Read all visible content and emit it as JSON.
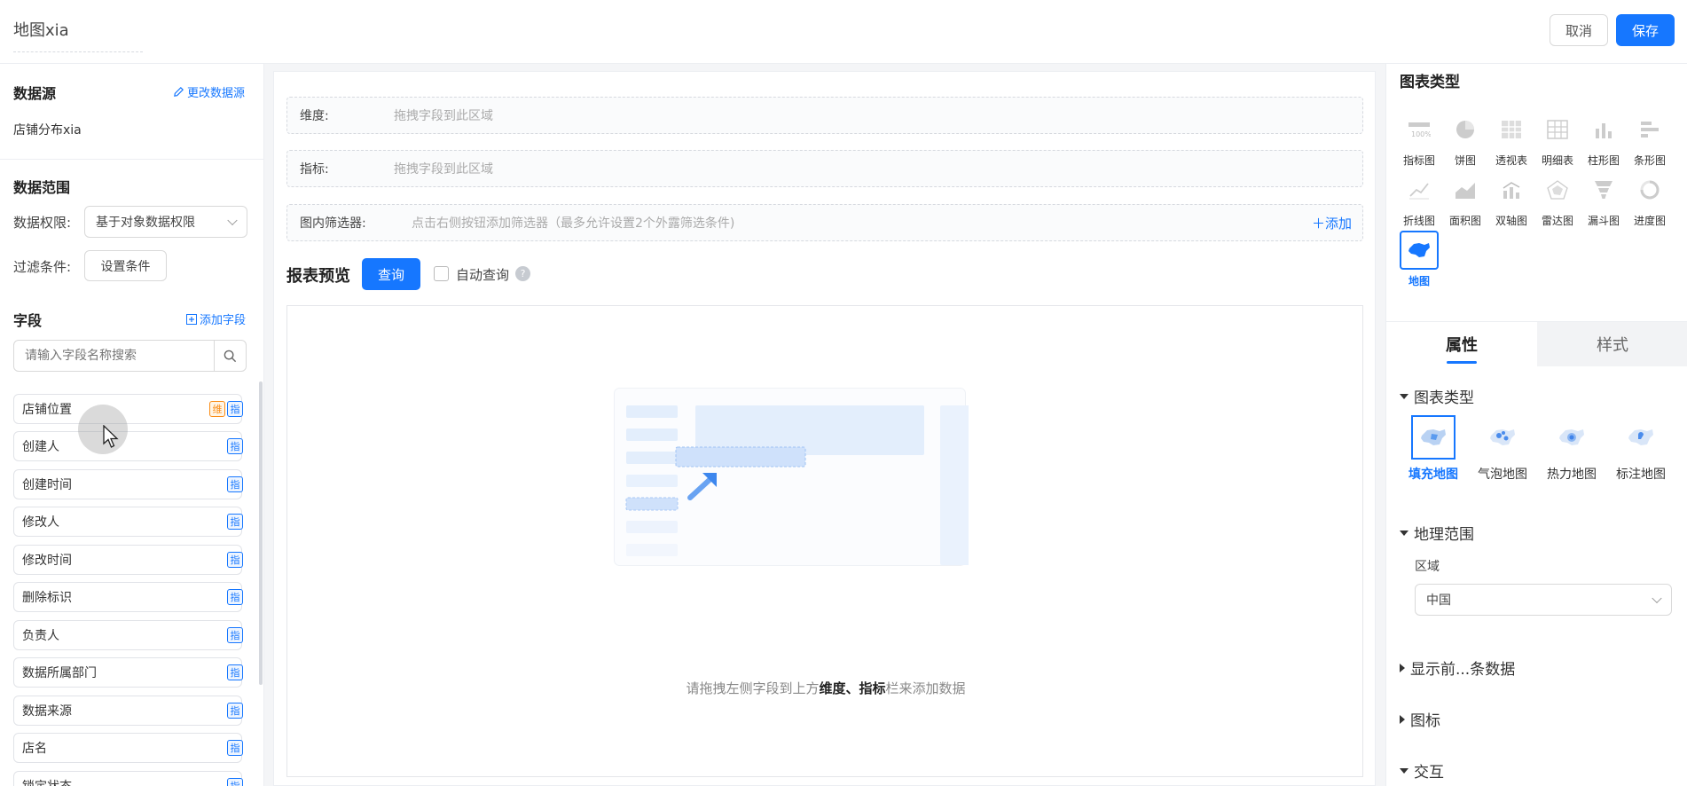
{
  "header": {
    "title": "地图xia",
    "cancel_label": "取消",
    "save_label": "保存"
  },
  "left": {
    "datasource_title": "数据源",
    "change_datasource_label": "更改数据源",
    "datasource_name": "店铺分布xia",
    "range_title": "数据范围",
    "permission_label": "数据权限:",
    "permission_value": "基于对象数据权限",
    "filter_label": "过滤条件:",
    "filter_button": "设置条件",
    "fields_title": "字段",
    "add_field_label": "添加字段",
    "search_placeholder": "请输入字段名称搜索",
    "fields": [
      {
        "name": "店铺位置",
        "dim": "维",
        "measure": "指"
      },
      {
        "name": "创建人",
        "measure": "指"
      },
      {
        "name": "创建时间",
        "measure": "指"
      },
      {
        "name": "修改人",
        "measure": "指"
      },
      {
        "name": "修改时间",
        "measure": "指"
      },
      {
        "name": "删除标识",
        "measure": "指"
      },
      {
        "name": "负责人",
        "measure": "指"
      },
      {
        "name": "数据所属部门",
        "measure": "指"
      },
      {
        "name": "数据来源",
        "measure": "指"
      },
      {
        "name": "店名",
        "measure": "指"
      },
      {
        "name": "锁定状态",
        "measure": "指"
      }
    ]
  },
  "center": {
    "dimension_label": "维度:",
    "dimension_placeholder": "拖拽字段到此区域",
    "measure_label": "指标:",
    "measure_placeholder": "拖拽字段到此区域",
    "filter_label": "图内筛选器:",
    "filter_placeholder": "点击右侧按钮添加筛选器（最多允许设置2个外露筛选条件)",
    "add_label": "添加",
    "preview_title": "报表预览",
    "query_label": "查询",
    "auto_query_label": "自动查询",
    "help_label": "?",
    "empty_prefix": "请拖拽左侧字段到上方",
    "empty_bold": "维度、指标",
    "empty_suffix": "栏来添加数据"
  },
  "right": {
    "chart_type_title": "图表类型",
    "chart_types": [
      {
        "label": "指标图",
        "icon": "indicator-chart-icon"
      },
      {
        "label": "饼图",
        "icon": "pie-chart-icon"
      },
      {
        "label": "透视表",
        "icon": "pivot-table-icon"
      },
      {
        "label": "明细表",
        "icon": "detail-table-icon"
      },
      {
        "label": "柱形图",
        "icon": "column-chart-icon"
      },
      {
        "label": "条形图",
        "icon": "bar-chart-icon"
      },
      {
        "label": "折线图",
        "icon": "line-chart-icon"
      },
      {
        "label": "面积图",
        "icon": "area-chart-icon"
      },
      {
        "label": "双轴图",
        "icon": "dual-axis-chart-icon"
      },
      {
        "label": "雷达图",
        "icon": "radar-chart-icon"
      },
      {
        "label": "漏斗图",
        "icon": "funnel-chart-icon"
      },
      {
        "label": "进度图",
        "icon": "progress-chart-icon"
      },
      {
        "label": "地图",
        "icon": "map-chart-icon",
        "active": true
      }
    ],
    "tab_properties": "属性",
    "tab_style": "样式",
    "section_chart_type": "图表类型",
    "map_types": [
      {
        "label": "填充地图",
        "active": true
      },
      {
        "label": "气泡地图"
      },
      {
        "label": "热力地图"
      },
      {
        "label": "标注地图"
      }
    ],
    "section_geo": "地理范围",
    "region_label": "区域",
    "region_value": "中国",
    "section_top_n": "显示前...条数据",
    "section_legend": "图标",
    "section_interaction": "交互"
  },
  "colors": {
    "accent": "#1677ff",
    "dim_tag": "#fa8c16"
  }
}
